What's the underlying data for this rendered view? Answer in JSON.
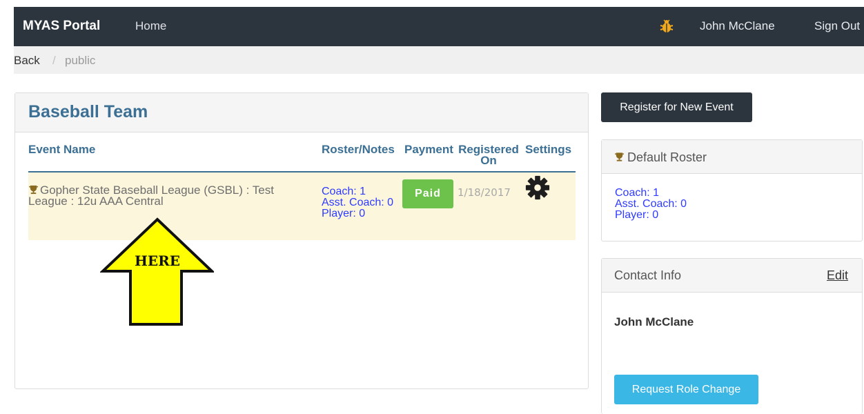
{
  "navbar": {
    "brand": "MYAS Portal",
    "home": "Home",
    "user": "John McClane",
    "signout": "Sign Out",
    "bug_icon": "bug-icon"
  },
  "breadcrumb": {
    "back": "Back",
    "separator": "/",
    "current": "public"
  },
  "team_panel": {
    "title": "Baseball Team",
    "columns": [
      "Event Name",
      "Roster/Notes",
      "Payment",
      "Registered On",
      "Settings"
    ],
    "rows": [
      {
        "event_name": "Gopher State Baseball League (GSBL) : Test League : 12u AAA Central",
        "roster_lines": [
          "Coach: 1",
          "Asst. Coach: 0",
          "Player: 0"
        ],
        "payment": "Paid",
        "registered_on": "1/18/2017",
        "settings_icon": "gear-icon"
      }
    ]
  },
  "annotation": {
    "label": "HERE",
    "color": "#ffff00"
  },
  "sidebar": {
    "register_button": "Register for New Event",
    "default_roster": {
      "title": "Default Roster",
      "lines": [
        "Coach: 1",
        "Asst. Coach: 0",
        "Player: 0"
      ]
    },
    "contact": {
      "title": "Contact Info",
      "edit": "Edit",
      "name": "John McClane",
      "role_button": "Request Role Change"
    }
  },
  "colors": {
    "navbar": "#2c343e",
    "heading_blue": "#3b6f94",
    "paid_green": "#6cc24a",
    "link_blue": "#2e3aff",
    "info_button": "#3bb7e6",
    "row_highlight": "#fcf7dc"
  }
}
